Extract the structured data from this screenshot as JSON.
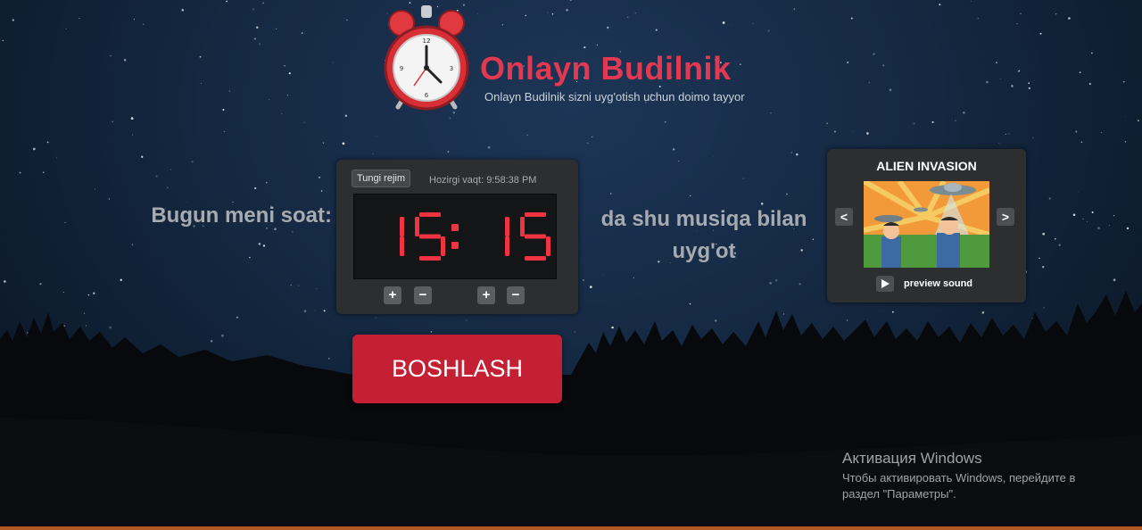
{
  "header": {
    "title": "Onlayn Budilnik",
    "subtitle": "Onlayn Budilnik sizni uyg'otish uchun doimo tayyor",
    "logo_icon": "alarm-clock-icon"
  },
  "alarm": {
    "lead_text": "Bugun meni soat:",
    "trail_text": "da shu musiqa bilan uyg'ot",
    "night_mode_label": "Tungi rejim",
    "current_time_label": "Hozirgi vaqt: 9:58:38 PM",
    "hours": "15",
    "minutes": "15",
    "separator": ":",
    "plus_label": "+",
    "minus_label": "−",
    "digit_color": "#f03340"
  },
  "music": {
    "track_title": "ALIEN INVASION",
    "prev_label": "<",
    "next_label": ">",
    "preview_label": "preview sound",
    "play_icon": "play-icon"
  },
  "start_button": {
    "label": "BOSHLASH",
    "color": "#c41f32"
  },
  "windows_watermark": {
    "title": "Активация Windows",
    "text": "Чтобы активировать Windows, перейдите в раздел \"Параметры\"."
  },
  "colors": {
    "brand": "#e33852",
    "panel": "#2c2e30",
    "accent_strip": "#b05a22"
  }
}
